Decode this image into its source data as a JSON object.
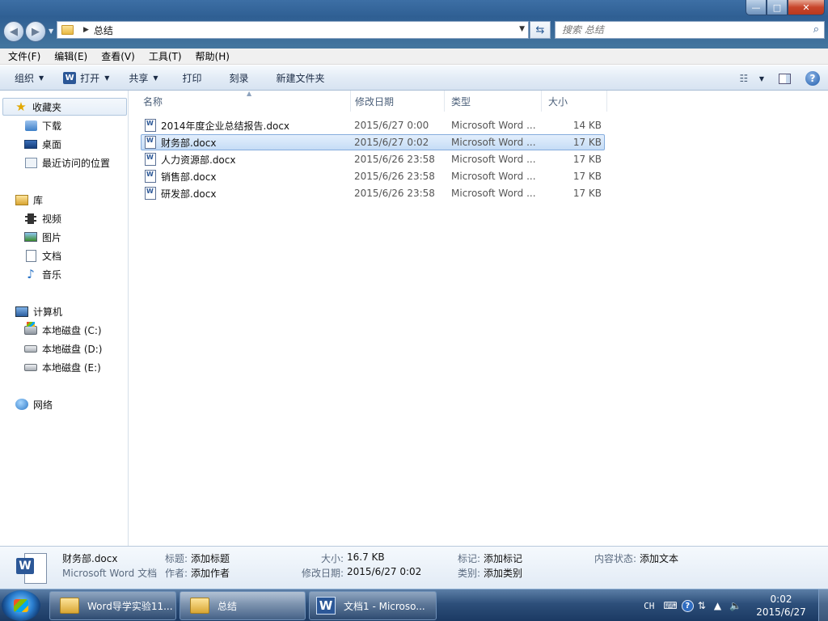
{
  "window": {
    "controls": {
      "minimize": "—",
      "maximize": "□",
      "close": "✕"
    }
  },
  "address": {
    "crumb": "总结"
  },
  "search": {
    "placeholder": "搜索 总结"
  },
  "menubar": {
    "items": [
      "文件(F)",
      "编辑(E)",
      "查看(V)",
      "工具(T)",
      "帮助(H)"
    ]
  },
  "commandbar": {
    "organize": "组织",
    "open": "打开",
    "share": "共享",
    "print": "打印",
    "burn": "刻录",
    "new_folder": "新建文件夹"
  },
  "navpane": {
    "favorites": "收藏夹",
    "downloads": "下载",
    "desktop": "桌面",
    "recent": "最近访问的位置",
    "libraries": "库",
    "videos": "视频",
    "pictures": "图片",
    "documents": "文档",
    "music": "音乐",
    "computer": "计算机",
    "drive_c": "本地磁盘 (C:)",
    "drive_d": "本地磁盘 (D:)",
    "drive_e": "本地磁盘 (E:)",
    "network": "网络"
  },
  "columns": {
    "name": "名称",
    "date": "修改日期",
    "type": "类型",
    "size": "大小"
  },
  "files": [
    {
      "name": "2014年度企业总结报告.docx",
      "date": "2015/6/27 0:00",
      "type": "Microsoft Word ...",
      "size": "14 KB",
      "selected": false
    },
    {
      "name": "财务部.docx",
      "date": "2015/6/27 0:02",
      "type": "Microsoft Word ...",
      "size": "17 KB",
      "selected": true
    },
    {
      "name": "人力资源部.docx",
      "date": "2015/6/26 23:58",
      "type": "Microsoft Word ...",
      "size": "17 KB",
      "selected": false
    },
    {
      "name": "销售部.docx",
      "date": "2015/6/26 23:58",
      "type": "Microsoft Word ...",
      "size": "17 KB",
      "selected": false
    },
    {
      "name": "研发部.docx",
      "date": "2015/6/26 23:58",
      "type": "Microsoft Word ...",
      "size": "17 KB",
      "selected": false
    }
  ],
  "details": {
    "filename": "财务部.docx",
    "filetype": "Microsoft Word 文档",
    "title_label": "标题:",
    "title_value": "添加标题",
    "author_label": "作者:",
    "author_value": "添加作者",
    "size_label": "大小:",
    "size_value": "16.7 KB",
    "modified_label": "修改日期:",
    "modified_value": "2015/6/27 0:02",
    "tags_label": "标记:",
    "tags_value": "添加标记",
    "category_label": "类别:",
    "category_value": "添加类别",
    "status_label": "内容状态:",
    "status_value": "添加文本"
  },
  "taskbar": {
    "buttons": [
      {
        "label": "Word导学实验11...",
        "icon": "folder-icon"
      },
      {
        "label": "总结",
        "icon": "folder-icon",
        "active": true
      },
      {
        "label": "文档1 - Microso...",
        "icon": "word-icon"
      }
    ],
    "tray": {
      "lang": "CH",
      "time": "0:02",
      "date": "2015/6/27"
    }
  },
  "colors": {
    "titlebar": "#2f5f93",
    "selection": "#c5dcf6",
    "word_blue": "#2b5797"
  }
}
